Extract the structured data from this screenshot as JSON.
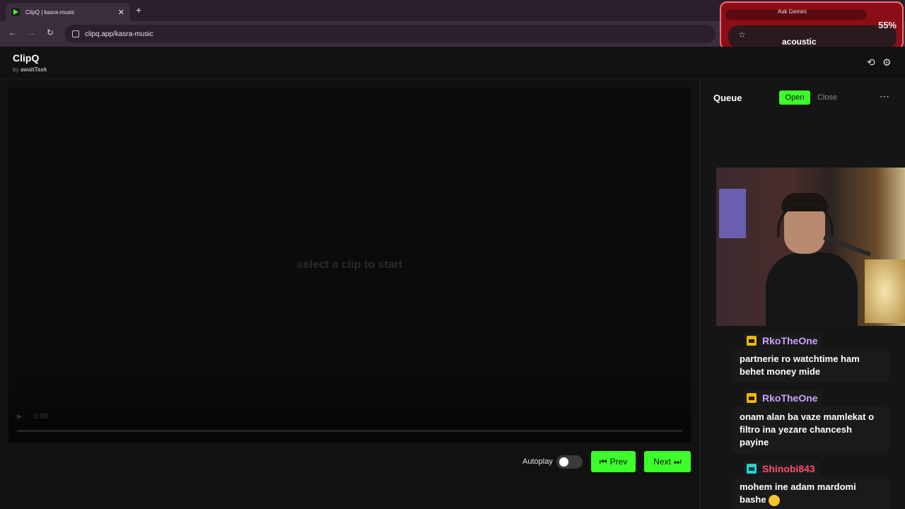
{
  "browser": {
    "tab_title": "ClipQ | kasra-music",
    "url": "clipq.app/kasra-music"
  },
  "overlay": {
    "gemini_label": "Ask Gemini",
    "percent": "55%",
    "tag": "acoustic"
  },
  "app": {
    "brand": "ClipQ",
    "byline_prefix": "by",
    "byline_author": "awaitTask"
  },
  "video": {
    "hint": "select a clip to start",
    "time": "0:00"
  },
  "controls": {
    "autoplay_label": "Autoplay",
    "autoplay_on": false,
    "prev_label": "Prev",
    "next_label": "Next"
  },
  "sidebar": {
    "title": "Queue",
    "open_label": "Open",
    "close_label": "Close"
  },
  "colors": {
    "accent": "#3cff2b",
    "username_purple": "#c9a3ff",
    "username_red": "#ff4d6d"
  },
  "chat": [
    {
      "username": "RkoTheOne",
      "message": "partnerie ro watchtime ham behet money mide"
    },
    {
      "username": "RkoTheOne",
      "message": "onam alan ba vaze mamlekat o filtro ina yezare chancesh payine"
    },
    {
      "username": "Shinobi843",
      "message": "mohem ine adam mardomi bashe"
    }
  ]
}
